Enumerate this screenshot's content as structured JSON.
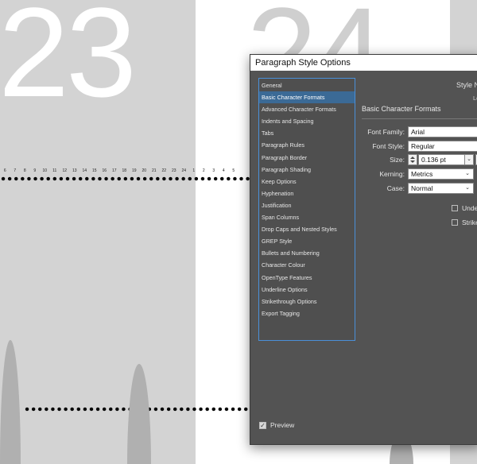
{
  "canvas": {
    "page_numbers": [
      "23",
      "24"
    ],
    "ruler_numbers": [
      "6",
      "7",
      "8",
      "9",
      "10",
      "11",
      "12",
      "13",
      "14",
      "15",
      "16",
      "17",
      "18",
      "19",
      "20",
      "21",
      "22",
      "23",
      "24",
      "1",
      "2",
      "3",
      "4",
      "5"
    ]
  },
  "dialog": {
    "title": "Paragraph Style Options",
    "style_name_label": "Style N",
    "location_label": "Lo",
    "categories": [
      "General",
      "Basic Character Formats",
      "Advanced Character Formats",
      "Indents and Spacing",
      "Tabs",
      "Paragraph Rules",
      "Paragraph Border",
      "Paragraph Shading",
      "Keep Options",
      "Hyphenation",
      "Justification",
      "Span Columns",
      "Drop Caps and Nested Styles",
      "GREP Style",
      "Bullets and Numbering",
      "Character Colour",
      "OpenType Features",
      "Underline Options",
      "Strikethrough Options",
      "Export Tagging"
    ],
    "selected_category": "Basic Character Formats",
    "section_title": "Basic Character Formats",
    "fields": {
      "font_family": {
        "label": "Font Family:",
        "value": "Arial"
      },
      "font_style": {
        "label": "Font Style:",
        "value": "Regular"
      },
      "size": {
        "label": "Size:",
        "value": "0.136 pt"
      },
      "kerning": {
        "label": "Kerning:",
        "value": "Metrics"
      },
      "case": {
        "label": "Case:",
        "value": "Normal"
      }
    },
    "checkboxes": {
      "underline": {
        "label": "Unde",
        "checked": false
      },
      "strikethrough": {
        "label": "Strike",
        "checked": false
      }
    },
    "preview": {
      "label": "Preview",
      "checked": true
    }
  },
  "colors": {
    "dialog_bg": "#535353",
    "selection": "#3b6a96",
    "list_border": "#4a90d9"
  }
}
